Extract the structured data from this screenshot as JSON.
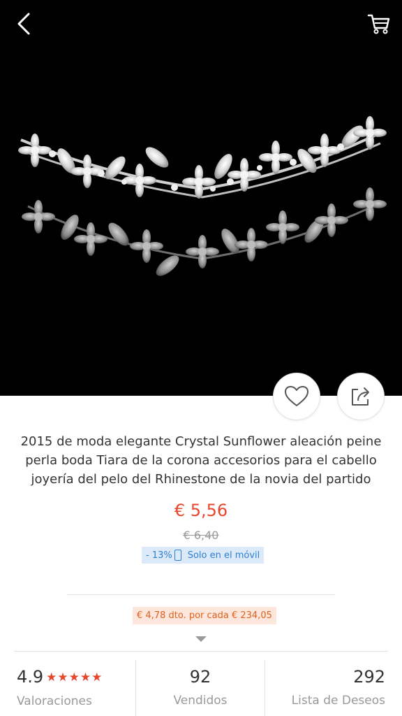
{
  "product": {
    "title": "2015 de moda elegante Crystal Sunflower aleación peine perla boda Tiara de la corona accesorios para el cabello joyería del pelo del Rhinestone de la novia del partido",
    "price": "€ 5,56",
    "original_price": "€ 6,40",
    "discount": "- 13%",
    "mobile_only": "Solo en el móvil",
    "coupon": "€ 4,78 dto. por cada € 234,05"
  },
  "stats": {
    "rating": "4.9",
    "stars": "★★★★★",
    "rating_label": "Valoraciones",
    "sold": "92",
    "sold_label": "Vendidos",
    "wishlist": "292",
    "wishlist_label": "Lista de Deseos"
  },
  "colors": {
    "price": "#e8452c",
    "promo_bg": "#dbe9f8",
    "promo_text": "#2f7fd0",
    "coupon_bg": "#fde6dc",
    "coupon_text": "#e0611f"
  },
  "icons": {
    "back": "chevron-left-icon",
    "cart": "cart-icon",
    "wishlist": "heart-icon",
    "share": "share-icon"
  }
}
